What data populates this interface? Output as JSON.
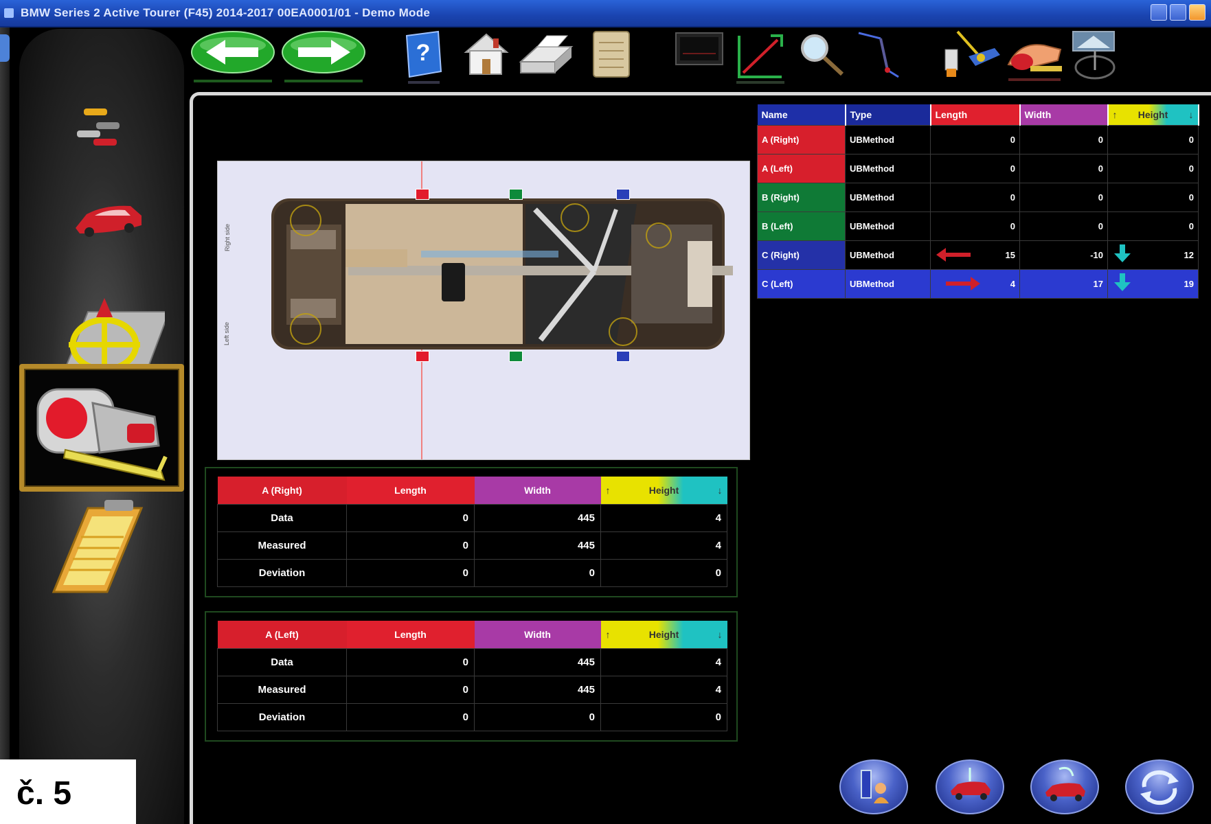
{
  "window": {
    "title": "BMW Series 2 Active Tourer (F45) 2014-2017 00EA0001/01 - Demo Mode"
  },
  "toolbar": {
    "buttons": [
      {
        "name": "back-icon"
      },
      {
        "name": "forward-icon"
      },
      {
        "name": "help-icon"
      },
      {
        "name": "home-icon"
      },
      {
        "name": "print-icon"
      },
      {
        "name": "notes-icon"
      },
      {
        "name": "monitor-icon"
      },
      {
        "name": "measure-diagonal-icon"
      },
      {
        "name": "zoom-icon"
      },
      {
        "name": "probe-icon"
      },
      {
        "name": "bracket-tool-icon"
      },
      {
        "name": "tape-measure-icon"
      },
      {
        "name": "camera-target-icon"
      }
    ]
  },
  "sidebar": {
    "items": [
      {
        "name": "vehicle-selection-icon",
        "selected": false
      },
      {
        "name": "vehicle-icon",
        "selected": false
      },
      {
        "name": "reference-points-icon",
        "selected": false
      },
      {
        "name": "measurement-icon",
        "selected": true
      },
      {
        "name": "report-clipboard-icon",
        "selected": false
      }
    ]
  },
  "diagram": {
    "side_label_top": "Right side",
    "side_label_bottom": "Left side",
    "colors": {
      "red": "#e21b2b",
      "green": "#0e8a3a",
      "blue": "#2a3fb8"
    }
  },
  "points_table": {
    "headers": [
      "Name",
      "Type",
      "Length",
      "Width",
      "Height"
    ],
    "rows": [
      {
        "name": "A (Right)",
        "type": "UBMethod",
        "length": "0",
        "width": "0",
        "height": "0",
        "group": "red",
        "selected": false
      },
      {
        "name": "A (Left)",
        "type": "UBMethod",
        "length": "0",
        "width": "0",
        "height": "0",
        "group": "red",
        "selected": false
      },
      {
        "name": "B (Right)",
        "type": "UBMethod",
        "length": "0",
        "width": "0",
        "height": "0",
        "group": "green",
        "selected": false
      },
      {
        "name": "B (Left)",
        "type": "UBMethod",
        "length": "0",
        "width": "0",
        "height": "0",
        "group": "green",
        "selected": false
      },
      {
        "name": "C (Right)",
        "type": "UBMethod",
        "length": "15",
        "width": "-10",
        "height": "12",
        "group": "blue",
        "selected": false
      },
      {
        "name": "C (Left)",
        "type": "UBMethod",
        "length": "4",
        "width": "17",
        "height": "19",
        "group": "blue",
        "selected": true
      }
    ]
  },
  "detail_tables": [
    {
      "point": "A (Right)",
      "headers": [
        "Length",
        "Width",
        "Height"
      ],
      "rows": [
        {
          "label": "Data",
          "length": "0",
          "width": "445",
          "height": "4"
        },
        {
          "label": "Measured",
          "length": "0",
          "width": "445",
          "height": "4"
        },
        {
          "label": "Deviation",
          "length": "0",
          "width": "0",
          "height": "0"
        }
      ]
    },
    {
      "point": "A (Left)",
      "headers": [
        "Length",
        "Width",
        "Height"
      ],
      "rows": [
        {
          "label": "Data",
          "length": "0",
          "width": "445",
          "height": "4"
        },
        {
          "label": "Measured",
          "length": "0",
          "width": "445",
          "height": "4"
        },
        {
          "label": "Deviation",
          "length": "0",
          "width": "0",
          "height": "0"
        }
      ]
    }
  ],
  "actions": [
    {
      "name": "operator-icon"
    },
    {
      "name": "car-lift-icon"
    },
    {
      "name": "car-reset-icon"
    },
    {
      "name": "refresh-icon"
    }
  ],
  "caption": "č. 5"
}
